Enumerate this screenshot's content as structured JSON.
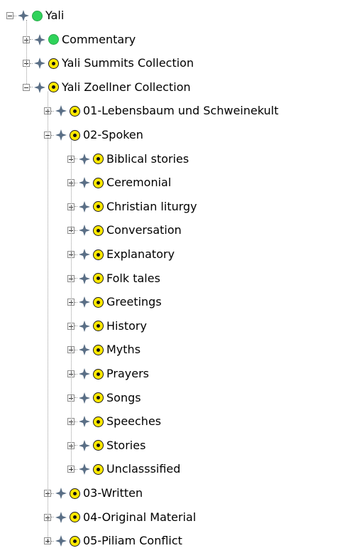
{
  "tree": {
    "root": {
      "label": "Yali",
      "expanded": true,
      "status": "green",
      "icons": [
        "collapse-icon",
        "move-icon",
        "green-status-icon"
      ]
    },
    "level1": [
      {
        "label": "Commentary",
        "expanded": false,
        "status": "green"
      },
      {
        "label": "Yali Summits Collection",
        "expanded": false,
        "status": "yellow"
      },
      {
        "label": "Yali Zoellner Collection",
        "expanded": true,
        "status": "yellow"
      }
    ],
    "level2": [
      {
        "label": "01-Lebensbaum und Schweinekult",
        "expanded": false,
        "status": "yellow"
      },
      {
        "label": "02-Spoken",
        "expanded": true,
        "status": "yellow"
      },
      {
        "label": "03-Written",
        "expanded": false,
        "status": "yellow"
      },
      {
        "label": "04-Original Material",
        "expanded": false,
        "status": "yellow"
      },
      {
        "label": "05-Piliam Conflict",
        "expanded": false,
        "status": "yellow"
      }
    ],
    "spoken_children": [
      {
        "label": "Biblical stories",
        "expanded": false,
        "status": "yellow"
      },
      {
        "label": "Ceremonial",
        "expanded": false,
        "status": "yellow"
      },
      {
        "label": "Christian liturgy",
        "expanded": false,
        "status": "yellow"
      },
      {
        "label": "Conversation",
        "expanded": false,
        "status": "yellow"
      },
      {
        "label": "Explanatory",
        "expanded": false,
        "status": "yellow"
      },
      {
        "label": "Folk tales",
        "expanded": false,
        "status": "yellow"
      },
      {
        "label": "Greetings",
        "expanded": false,
        "status": "yellow"
      },
      {
        "label": "History",
        "expanded": false,
        "status": "yellow"
      },
      {
        "label": "Myths",
        "expanded": false,
        "status": "yellow"
      },
      {
        "label": "Prayers",
        "expanded": false,
        "status": "yellow"
      },
      {
        "label": "Songs",
        "expanded": false,
        "status": "yellow"
      },
      {
        "label": "Speeches",
        "expanded": false,
        "status": "yellow"
      },
      {
        "label": "Stories",
        "expanded": false,
        "status": "yellow"
      },
      {
        "label": "Unclasssified",
        "expanded": false,
        "status": "yellow"
      }
    ]
  }
}
